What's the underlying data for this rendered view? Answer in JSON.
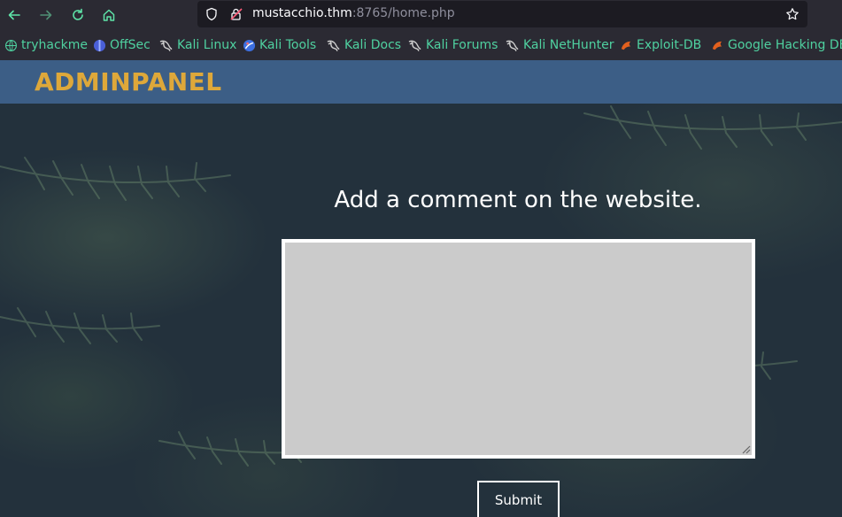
{
  "browser": {
    "url_host": "mustacchio.thm",
    "url_rest": ":8765/home.php",
    "bookmarks": [
      {
        "label": "tryhackme",
        "icon": "globe-icon"
      },
      {
        "label": "OffSec",
        "icon": "offsec-icon"
      },
      {
        "label": "Kali Linux",
        "icon": "kali-dragon-icon"
      },
      {
        "label": "Kali Tools",
        "icon": "kali-tools-icon"
      },
      {
        "label": "Kali Docs",
        "icon": "kali-dragon-icon"
      },
      {
        "label": "Kali Forums",
        "icon": "kali-dragon-icon"
      },
      {
        "label": "Kali NetHunter",
        "icon": "kali-dragon-icon"
      },
      {
        "label": "Exploit-DB",
        "icon": "exploit-db-icon"
      },
      {
        "label": "Google Hacking DB",
        "icon": "exploit-db-icon"
      }
    ]
  },
  "header": {
    "brand": "ADMINPANEL"
  },
  "main": {
    "comment_title": "Add a comment on the website.",
    "comment_value": "",
    "submit_label": "Submit"
  },
  "colors": {
    "header_bg": "#3c5e86",
    "brand": "#dea83a",
    "textarea_bg": "#cbcbcb",
    "bookmark_text": "#4fd1a0"
  }
}
